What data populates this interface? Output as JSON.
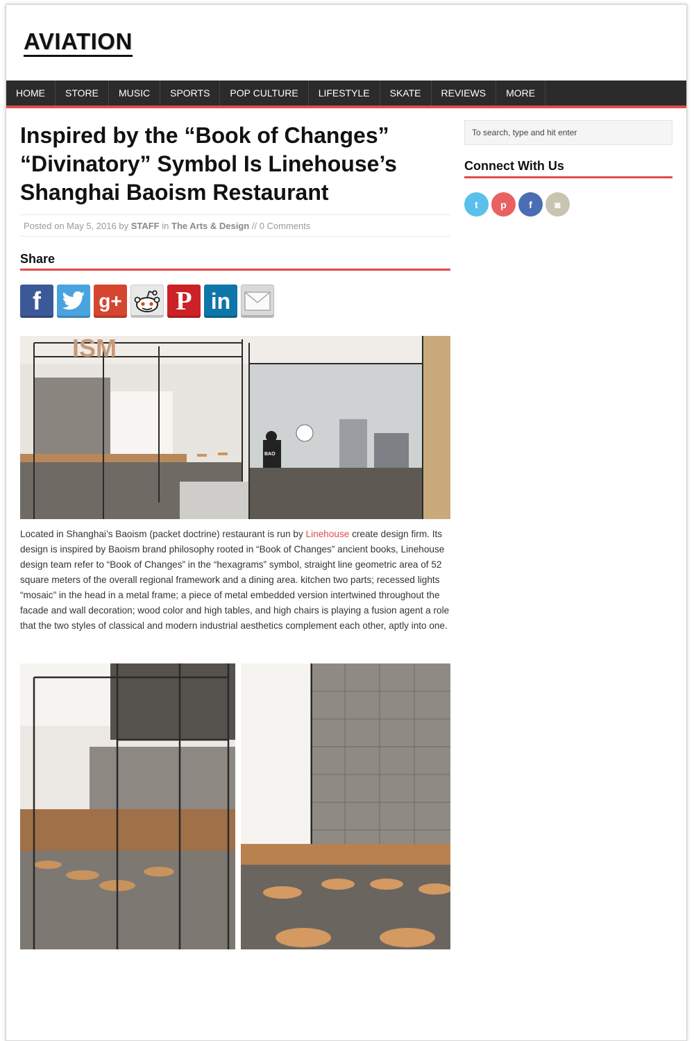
{
  "site": {
    "logo": "AVIATION"
  },
  "nav": {
    "items": [
      "HOME",
      "STORE",
      "MUSIC",
      "SPORTS",
      "POP CULTURE",
      "LIFESTYLE",
      "SKATE",
      "REVIEWS",
      "MORE"
    ]
  },
  "article": {
    "title": "Inspired by the “Book of Changes” “Divinatory” Symbol Is Linehouse’s Shanghai Baoism Restaurant",
    "meta": {
      "posted_prefix": "Posted on",
      "date": "May 5, 2016",
      "by": "by",
      "author": "STAFF",
      "in": "in",
      "category": "The Arts & Design",
      "separator": "//",
      "comments": "0 Comments"
    },
    "share_heading": "Share",
    "share_buttons": [
      {
        "name": "facebook",
        "glyph": "f",
        "color": "#3b5998"
      },
      {
        "name": "twitter",
        "glyph": "t",
        "color": "#4aa3df"
      },
      {
        "name": "google-plus",
        "glyph": "g+",
        "color": "#d6452f"
      },
      {
        "name": "reddit",
        "glyph": "r",
        "color": "#e8e8e8"
      },
      {
        "name": "pinterest",
        "glyph": "P",
        "color": "#cc2127"
      },
      {
        "name": "linkedin",
        "glyph": "in",
        "color": "#0e76a8"
      },
      {
        "name": "email",
        "glyph": "✉",
        "color": "#d9d9d9"
      }
    ],
    "photo_caption": "ISM",
    "photo_shirt_text": "BAO",
    "body": {
      "p1_before_link": "Located in Shanghai’s Baoism (packet doctrine) restaurant is run by ",
      "link": "Linehouse",
      "p1_after_link": " create design firm. Its design is inspired by Baoism brand philosophy rooted in “Book of Changes” ancient books, Linehouse design team refer to “Book of Changes” in the “hexagrams” symbol, straight line geometric area of 52 square meters of the overall regional framework and a dining area. kitchen two parts; recessed lights “mosaic” in the head in a metal frame; a piece of metal embedded version intertwined throughout the facade and wall decoration; wood color and high tables, and high chairs is playing a fusion agent a role that the two styles of classical and modern industrial aesthetics complement each other, aptly into one."
    }
  },
  "sidebar": {
    "search_placeholder": "To search, type and hit enter",
    "connect_heading": "Connect With Us",
    "social": [
      {
        "name": "twitter",
        "glyph": "t",
        "color": "#5bc0eb"
      },
      {
        "name": "pinterest",
        "glyph": "p",
        "color": "#e86060"
      },
      {
        "name": "facebook",
        "glyph": "f",
        "color": "#4a6db4"
      },
      {
        "name": "instagram",
        "glyph": "◙",
        "color": "#c8c4b0"
      }
    ]
  },
  "colors": {
    "accent": "#e04b4b",
    "nav_bg": "#2b2b2b"
  }
}
